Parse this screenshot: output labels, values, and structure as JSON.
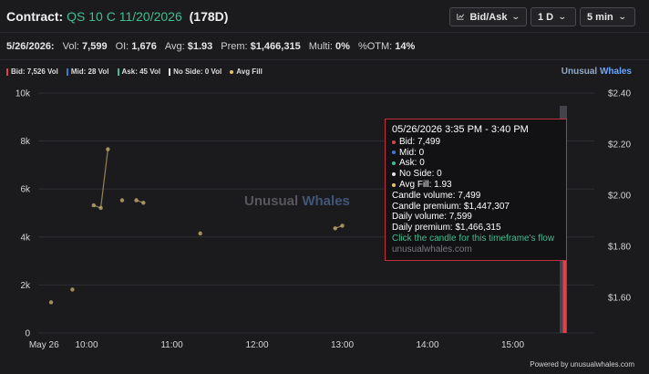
{
  "header": {
    "label": "Contract:",
    "ticker": "QS 10 C 11/20/2026",
    "days": "(178D)",
    "controls": [
      {
        "name": "bid-ask-dropdown",
        "label": "Bid/Ask",
        "icon": "chart-icon"
      },
      {
        "name": "range-dropdown",
        "label": "1 D"
      },
      {
        "name": "interval-dropdown",
        "label": "5 min"
      }
    ]
  },
  "stats": {
    "date": "5/26/2026:",
    "vol_label": "Vol:",
    "vol": "7,599",
    "oi_label": "OI:",
    "oi": "1,676",
    "avg_label": "Avg:",
    "avg": "$1.93",
    "prem_label": "Prem:",
    "prem": "$1,466,315",
    "multi_label": "Multi:",
    "multi": "0%",
    "otm_label": "%OTM:",
    "otm": "14%"
  },
  "legend": [
    {
      "label": "Bid: 7,526 Vol",
      "color": "#e0414f",
      "shape": "bar"
    },
    {
      "label": "Mid: 28 Vol",
      "color": "#3a7bd5",
      "shape": "bar"
    },
    {
      "label": "Ask: 45 Vol",
      "color": "#3fbf8f",
      "shape": "bar"
    },
    {
      "label": "No Side: 0 Vol",
      "color": "#e6e6e6",
      "shape": "bar"
    },
    {
      "label": "Avg Fill",
      "color": "#e8c36a",
      "shape": "dot"
    }
  ],
  "brand": {
    "a": "Unusual",
    "b": "Whales"
  },
  "watermark": {
    "a": "Unusual",
    "b": "Whales"
  },
  "chart_data": {
    "type": "bar",
    "x_ticks": [
      "May 26",
      "10:00",
      "11:00",
      "12:00",
      "13:00",
      "14:00",
      "15:00"
    ],
    "y_left_ticks": [
      "0",
      "2k",
      "4k",
      "6k",
      "8k",
      "10k"
    ],
    "y_left_range": [
      0,
      10000
    ],
    "y_right_ticks": [
      "$1.60",
      "$1.80",
      "$2.00",
      "$2.20",
      "$2.40"
    ],
    "y_right_range": [
      1.46,
      2.4
    ],
    "volume_bars": [
      {
        "time": "15:35",
        "bid": 7499,
        "mid": 0,
        "ask": 0,
        "no_side": 0
      }
    ],
    "avg_fill": [
      {
        "time": "09:35",
        "price": 1.58
      },
      {
        "time": "09:50",
        "price": 1.63
      },
      {
        "time": "10:05",
        "price": 1.96
      },
      {
        "time": "10:10",
        "price": 1.95
      },
      {
        "time": "10:15",
        "price": 2.18
      },
      {
        "time": "10:25",
        "price": 1.98
      },
      {
        "time": "10:35",
        "price": 1.98
      },
      {
        "time": "10:40",
        "price": 1.97
      },
      {
        "time": "11:20",
        "price": 1.85
      },
      {
        "time": "12:55",
        "price": 1.87
      },
      {
        "time": "13:00",
        "price": 1.88
      },
      {
        "time": "15:35",
        "price": 1.93
      }
    ],
    "line_segments": [
      [
        2,
        3
      ],
      [
        3,
        4
      ],
      [
        6,
        7
      ],
      [
        9,
        10
      ]
    ],
    "colors": {
      "bid": "#e0414f",
      "avg_fill": "#b9a56a",
      "grid": "#2e2e33",
      "hover_column": "#4b4b52"
    }
  },
  "tooltip": {
    "title": "05/26/2026 3:35 PM - 3:40 PM",
    "bid": "Bid: 7,499",
    "mid": "Mid: 0",
    "ask": "Ask: 0",
    "no_side": "No Side: 0",
    "avg_fill": "Avg Fill: 1.93",
    "candle_volume": "Candle volume: 7,499",
    "candle_premium": "Candle premium: $1,447,307",
    "daily_volume": "Daily volume: 7,599",
    "daily_premium": "Daily premium: $1,466,315",
    "cta": "Click the candle for this timeframe's flow",
    "source": "unusualwhales.com"
  },
  "footer": {
    "powered": "Powered by unusualwhales.com"
  }
}
